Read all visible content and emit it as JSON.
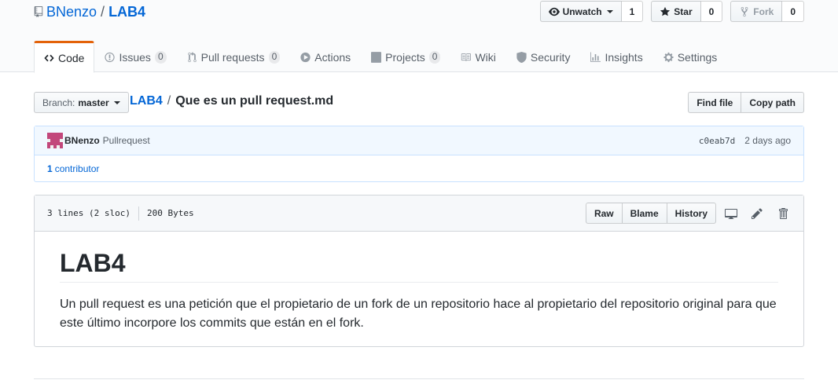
{
  "repo": {
    "owner": "BNenzo",
    "separator": "/",
    "name": "LAB4"
  },
  "actions": {
    "watch": {
      "label": "Unwatch",
      "count": "1"
    },
    "star": {
      "label": "Star",
      "count": "0"
    },
    "fork": {
      "label": "Fork",
      "count": "0"
    }
  },
  "nav": {
    "code": "Code",
    "issues": {
      "label": "Issues",
      "count": "0"
    },
    "pulls": {
      "label": "Pull requests",
      "count": "0"
    },
    "actions": "Actions",
    "projects": {
      "label": "Projects",
      "count": "0"
    },
    "wiki": "Wiki",
    "security": "Security",
    "insights": "Insights",
    "settings": "Settings"
  },
  "file_nav": {
    "branch_prefix": "Branch:",
    "branch": "master",
    "crumb_repo": "LAB4",
    "crumb_sep": "/",
    "file_name": "Que es un pull request.md",
    "find_file": "Find file",
    "copy_path": "Copy path"
  },
  "commit": {
    "author": "BNenzo",
    "message": "Pullrequest",
    "sha": "c0eab7d",
    "when": "2 days ago",
    "contributors_count": "1",
    "contributors_label": "contributor"
  },
  "file": {
    "lines": "3 lines (2 sloc)",
    "size": "200 Bytes",
    "raw": "Raw",
    "blame": "Blame",
    "history": "History"
  },
  "content": {
    "heading": "LAB4",
    "paragraph": "Un pull request es una petición que el propietario de un fork de un repositorio hace al propietario del repositorio original para que este último incorpore los commits que están en el fork."
  },
  "colors": {
    "accent": "#e36209",
    "link": "#0366d6"
  }
}
